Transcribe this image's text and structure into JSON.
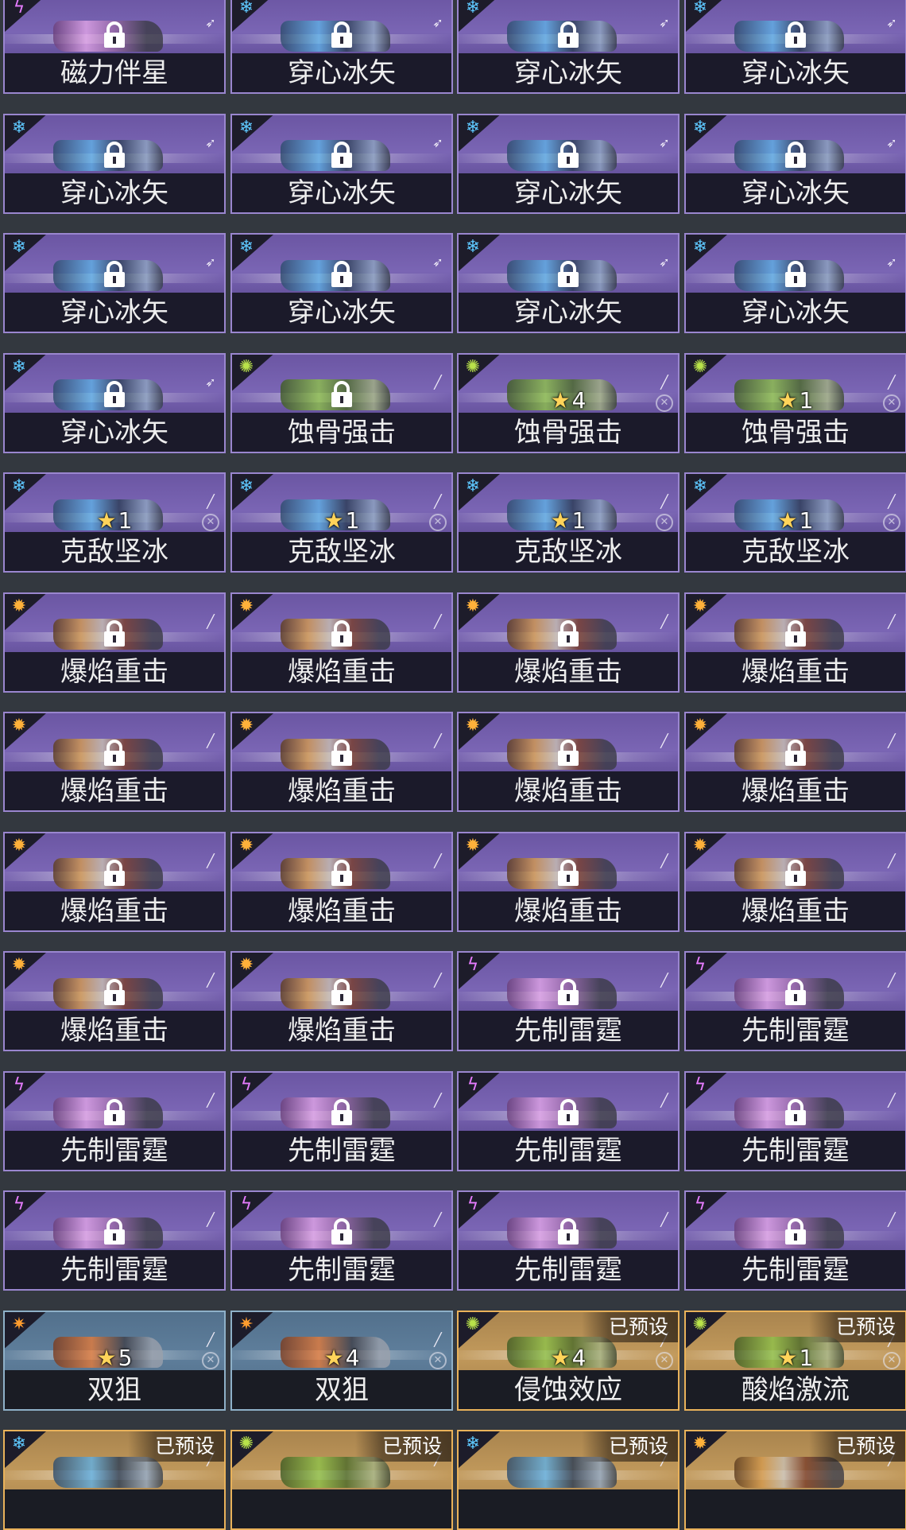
{
  "preset_label": "已预设",
  "cards": [
    {
      "name": "磁力伴星",
      "elem": "thunder",
      "type": "bow",
      "locked": true
    },
    {
      "name": "穿心冰矢",
      "elem": "ice",
      "type": "bow",
      "locked": true
    },
    {
      "name": "穿心冰矢",
      "elem": "ice",
      "type": "bow",
      "locked": true
    },
    {
      "name": "穿心冰矢",
      "elem": "ice",
      "type": "bow",
      "locked": true
    },
    {
      "name": "穿心冰矢",
      "elem": "ice",
      "type": "bow",
      "locked": true
    },
    {
      "name": "穿心冰矢",
      "elem": "ice",
      "type": "bow",
      "locked": true
    },
    {
      "name": "穿心冰矢",
      "elem": "ice",
      "type": "bow",
      "locked": true
    },
    {
      "name": "穿心冰矢",
      "elem": "ice",
      "type": "bow",
      "locked": true
    },
    {
      "name": "穿心冰矢",
      "elem": "ice",
      "type": "bow",
      "locked": true
    },
    {
      "name": "穿心冰矢",
      "elem": "ice",
      "type": "bow",
      "locked": true
    },
    {
      "name": "穿心冰矢",
      "elem": "ice",
      "type": "bow",
      "locked": true
    },
    {
      "name": "穿心冰矢",
      "elem": "ice",
      "type": "bow",
      "locked": true
    },
    {
      "name": "穿心冰矢",
      "elem": "ice",
      "type": "bow",
      "locked": true
    },
    {
      "name": "蚀骨强击",
      "elem": "acid",
      "type": "rifle",
      "locked": true
    },
    {
      "name": "蚀骨强击",
      "elem": "acid",
      "type": "rifle",
      "stars": "4"
    },
    {
      "name": "蚀骨强击",
      "elem": "acid",
      "type": "rifle",
      "stars": "1"
    },
    {
      "name": "克敌坚冰",
      "elem": "ice",
      "type": "rifle",
      "stars": "1"
    },
    {
      "name": "克敌坚冰",
      "elem": "ice",
      "type": "rifle",
      "stars": "1"
    },
    {
      "name": "克敌坚冰",
      "elem": "ice",
      "type": "rifle",
      "stars": "1"
    },
    {
      "name": "克敌坚冰",
      "elem": "ice",
      "type": "rifle",
      "stars": "1"
    },
    {
      "name": "爆焰重击",
      "elem": "fire",
      "type": "rifle",
      "locked": true
    },
    {
      "name": "爆焰重击",
      "elem": "fire",
      "type": "rifle",
      "locked": true
    },
    {
      "name": "爆焰重击",
      "elem": "fire",
      "type": "rifle",
      "locked": true
    },
    {
      "name": "爆焰重击",
      "elem": "fire",
      "type": "rifle",
      "locked": true
    },
    {
      "name": "爆焰重击",
      "elem": "fire",
      "type": "rifle",
      "locked": true
    },
    {
      "name": "爆焰重击",
      "elem": "fire",
      "type": "rifle",
      "locked": true
    },
    {
      "name": "爆焰重击",
      "elem": "fire",
      "type": "rifle",
      "locked": true
    },
    {
      "name": "爆焰重击",
      "elem": "fire",
      "type": "rifle",
      "locked": true
    },
    {
      "name": "爆焰重击",
      "elem": "fire",
      "type": "rifle",
      "locked": true
    },
    {
      "name": "爆焰重击",
      "elem": "fire",
      "type": "rifle",
      "locked": true
    },
    {
      "name": "爆焰重击",
      "elem": "fire",
      "type": "rifle",
      "locked": true
    },
    {
      "name": "爆焰重击",
      "elem": "fire",
      "type": "rifle",
      "locked": true
    },
    {
      "name": "爆焰重击",
      "elem": "fire",
      "type": "rifle",
      "locked": true
    },
    {
      "name": "爆焰重击",
      "elem": "fire",
      "type": "rifle",
      "locked": true
    },
    {
      "name": "先制雷霆",
      "elem": "thunder",
      "type": "rifle",
      "locked": true
    },
    {
      "name": "先制雷霆",
      "elem": "thunder",
      "type": "rifle",
      "locked": true
    },
    {
      "name": "先制雷霆",
      "elem": "thunder",
      "type": "rifle",
      "locked": true
    },
    {
      "name": "先制雷霆",
      "elem": "thunder",
      "type": "rifle",
      "locked": true
    },
    {
      "name": "先制雷霆",
      "elem": "thunder",
      "type": "rifle",
      "locked": true
    },
    {
      "name": "先制雷霆",
      "elem": "thunder",
      "type": "rifle",
      "locked": true
    },
    {
      "name": "先制雷霆",
      "elem": "thunder",
      "type": "rifle",
      "locked": true
    },
    {
      "name": "先制雷霆",
      "elem": "thunder",
      "type": "rifle",
      "locked": true
    },
    {
      "name": "先制雷霆",
      "elem": "thunder",
      "type": "rifle",
      "locked": true
    },
    {
      "name": "先制雷霆",
      "elem": "thunder",
      "type": "rifle",
      "locked": true
    },
    {
      "name": "双狙",
      "elem": "sun",
      "type": "rifle",
      "stars": "5",
      "tier": "blue"
    },
    {
      "name": "双狙",
      "elem": "sun",
      "type": "rifle",
      "stars": "4",
      "tier": "blue"
    },
    {
      "name": "侵蚀效应",
      "elem": "acid",
      "type": "rifle",
      "stars": "4",
      "tier": "gold",
      "preset": true
    },
    {
      "name": "酸焰激流",
      "elem": "acid",
      "type": "rifle",
      "stars": "1",
      "tier": "gold",
      "preset": true
    },
    {
      "name": "",
      "elem": "ice",
      "type": "rifle",
      "tier": "gold",
      "preset": true
    },
    {
      "name": "",
      "elem": "acid",
      "type": "rifle",
      "tier": "gold",
      "preset": true
    },
    {
      "name": "",
      "elem": "ice",
      "type": "rifle",
      "tier": "gold",
      "preset": true
    },
    {
      "name": "",
      "elem": "fire",
      "type": "rifle",
      "tier": "gold",
      "preset": true
    }
  ],
  "element_colors": {
    "ice": "#5ec8ff",
    "acid": "#b9e34a",
    "fire": "#ffb13a",
    "thunder": "#e67cff",
    "sun": "#ff9c2e"
  },
  "element_icons": {
    "ice": "ice-crystal-icon",
    "acid": "acid-splash-icon",
    "fire": "fire-burst-icon",
    "thunder": "thunder-claw-icon",
    "sun": "sun-cog-icon"
  }
}
